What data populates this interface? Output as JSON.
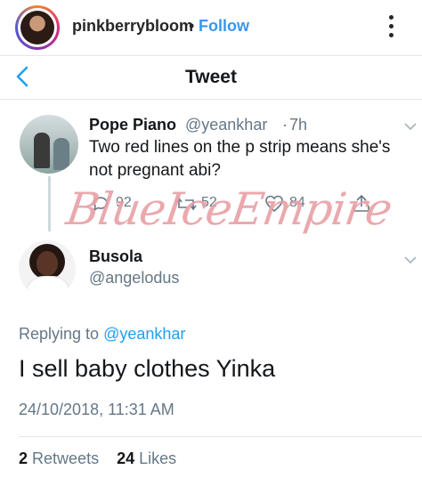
{
  "instagram": {
    "username": "pinkberrybloom",
    "separator": "•",
    "follow_label": "Follow",
    "more_icon": "more-vertical-icon"
  },
  "tweet_header": {
    "title": "Tweet",
    "back_icon": "chevron-left-icon"
  },
  "original_tweet": {
    "name": "Pope Piano",
    "handle": "@yeankhar",
    "separator": "·",
    "time": "7h",
    "text": "Two red lines on the p strip means she's not pregnant abi?",
    "actions": {
      "replies": "92",
      "retweets": "52",
      "likes": "84"
    }
  },
  "watermark": "BlueIceEmpire",
  "reply_tweet": {
    "name": "Busola",
    "handle": "@angelodus",
    "replying_prefix": "Replying to",
    "replying_to": "@yeankhar",
    "text": "I sell baby clothes Yinka",
    "timestamp": "24/10/2018, 11:31 AM",
    "retweets_count": "2",
    "retweets_label": "Retweets",
    "likes_count": "24",
    "likes_label": "Likes"
  },
  "colors": {
    "accent": "#1da1f2",
    "instagram_link": "#3897f0",
    "muted": "#657786",
    "watermark": "#e8a0a6"
  }
}
